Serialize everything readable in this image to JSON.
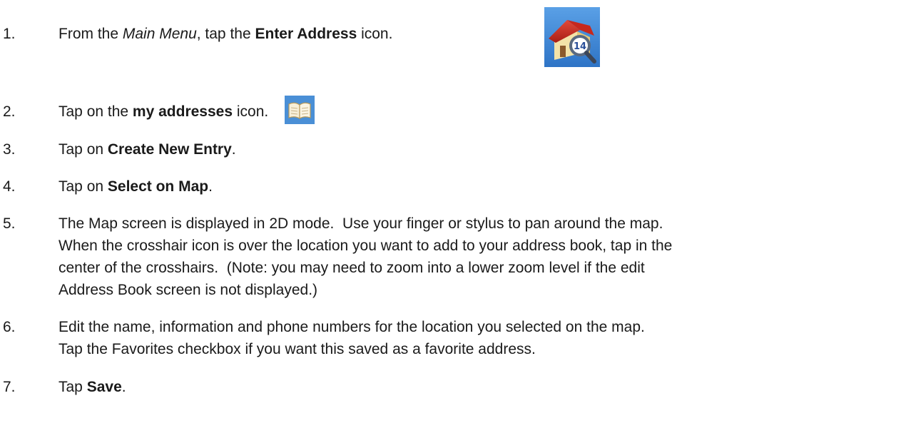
{
  "steps": [
    {
      "number": "1.",
      "parts": [
        {
          "t": "From the ",
          "s": "normal"
        },
        {
          "t": "Main Menu",
          "s": "italic"
        },
        {
          "t": ", tap the ",
          "s": "normal"
        },
        {
          "t": "Enter Address",
          "s": "bold"
        },
        {
          "t": " icon.",
          "s": "normal"
        }
      ],
      "icon": "house-magnifier-icon"
    },
    {
      "number": "2.",
      "parts": [
        {
          "t": "Tap on the ",
          "s": "normal"
        },
        {
          "t": "my addresses",
          "s": "bold"
        },
        {
          "t": " icon.",
          "s": "normal"
        }
      ],
      "icon": "address-book-icon"
    },
    {
      "number": "3.",
      "parts": [
        {
          "t": "Tap on ",
          "s": "normal"
        },
        {
          "t": "Create New Entry",
          "s": "bold"
        },
        {
          "t": ".",
          "s": "normal"
        }
      ]
    },
    {
      "number": "4.",
      "parts": [
        {
          "t": "Tap on ",
          "s": "normal"
        },
        {
          "t": "Select on Map",
          "s": "bold"
        },
        {
          "t": ".",
          "s": "normal"
        }
      ]
    },
    {
      "number": "5.",
      "lines": [
        "The Map screen is displayed in 2D mode.  Use your finger or stylus to pan around the map.",
        "When the crosshair icon is over the location you want to add to your address book, tap in the",
        "center of the crosshairs.  (Note: you may need to zoom into a lower zoom level if the edit",
        "Address Book screen is not displayed.)"
      ]
    },
    {
      "number": "6.",
      "lines": [
        "Edit the name, information and phone numbers for the location you selected on the map.",
        "Tap the Favorites checkbox if you want this saved as a favorite address."
      ]
    },
    {
      "number": "7.",
      "parts": [
        {
          "t": "Tap ",
          "s": "normal"
        },
        {
          "t": "Save",
          "s": "bold"
        },
        {
          "t": ".",
          "s": "normal"
        }
      ]
    }
  ]
}
